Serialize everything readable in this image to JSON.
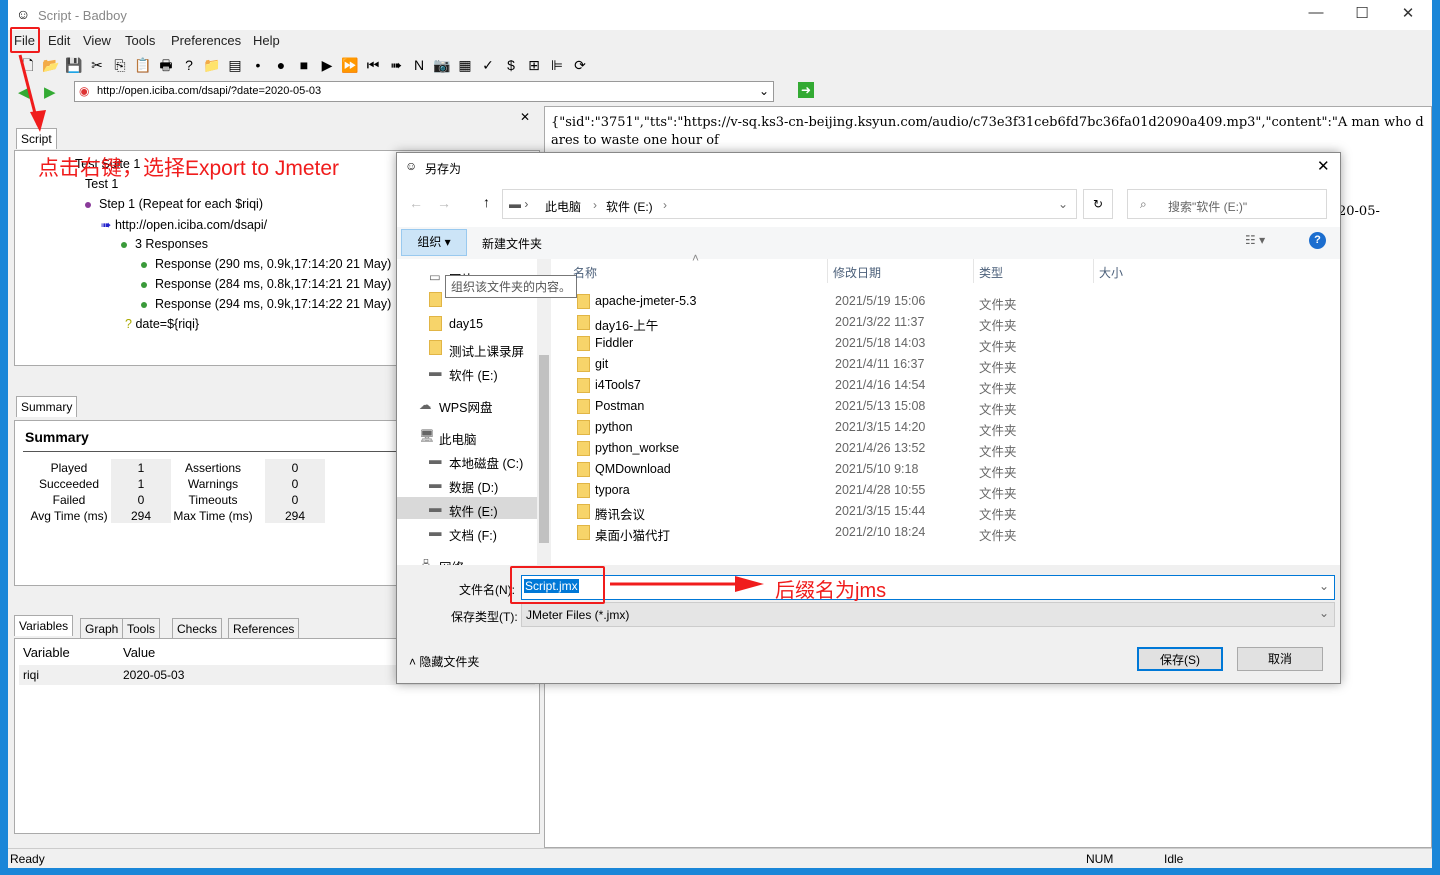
{
  "window": {
    "title": "Script - Badboy",
    "minimize": "—",
    "maximize": "☐",
    "close": "✕"
  },
  "menu": [
    "File",
    "Edit",
    "View",
    "Tools",
    "Preferences",
    "Help"
  ],
  "toolbar": [
    {
      "icon": "new-icon",
      "glyph": "🗋"
    },
    {
      "icon": "open-icon",
      "glyph": "📂"
    },
    {
      "icon": "save-icon",
      "glyph": "💾"
    },
    {
      "icon": "cut-icon",
      "glyph": "✂"
    },
    {
      "icon": "copy-icon",
      "glyph": "⎘"
    },
    {
      "icon": "paste-icon",
      "glyph": "📋"
    },
    {
      "icon": "print-icon",
      "glyph": "🖶"
    },
    {
      "icon": "help-icon",
      "glyph": "?"
    },
    {
      "icon": "add-suite-icon",
      "glyph": "📁"
    },
    {
      "icon": "add-test-icon",
      "glyph": "▤"
    },
    {
      "icon": "add-step-icon",
      "glyph": "•"
    },
    {
      "icon": "record-icon",
      "glyph": "●"
    },
    {
      "icon": "stop-icon",
      "glyph": "■"
    },
    {
      "icon": "play-icon",
      "glyph": "▶"
    },
    {
      "icon": "play-all-icon",
      "glyph": "⏩"
    },
    {
      "icon": "rewind-icon",
      "glyph": "⏮"
    },
    {
      "icon": "step-icon",
      "glyph": "➠"
    },
    {
      "icon": "n-icon",
      "glyph": "N"
    },
    {
      "icon": "camera-icon",
      "glyph": "📷"
    },
    {
      "icon": "report-icon",
      "glyph": "▦"
    },
    {
      "icon": "check-icon",
      "glyph": "✓"
    },
    {
      "icon": "dollar-icon",
      "glyph": "$"
    },
    {
      "icon": "table-icon",
      "glyph": "⊞"
    },
    {
      "icon": "chart-icon",
      "glyph": "⊫"
    },
    {
      "icon": "refresh-icon",
      "glyph": "⟳"
    }
  ],
  "address": {
    "url": "http://open.iciba.com/dsapi/?date=2020-05-03"
  },
  "script_tab": "Script",
  "tree": [
    "Test Suite 1",
    "Test 1",
    "Step 1 (Repeat for each $riqi)",
    "http://open.iciba.com/dsapi/",
    "3 Responses",
    "Response (290 ms, 0.9k,17:14:20 21 May)",
    "Response (284 ms, 0.8k,17:14:21 21 May)",
    "Response (294 ms, 0.9k,17:14:22 21 May)",
    "date=${riqi}"
  ],
  "summary": {
    "tab": "Summary",
    "heading": "Summary",
    "left": [
      [
        "Played",
        "1"
      ],
      [
        "Succeeded",
        "1"
      ],
      [
        "Failed",
        "0"
      ],
      [
        "Avg Time (ms)",
        "294"
      ]
    ],
    "right": [
      [
        "Assertions",
        "0"
      ],
      [
        "Warnings",
        "0"
      ],
      [
        "Timeouts",
        "0"
      ],
      [
        "Max Time (ms)",
        "294"
      ]
    ]
  },
  "bottom_tabs": [
    "Variables",
    "Graph",
    "Tools",
    "Checks",
    "References"
  ],
  "variables": {
    "headers": [
      "Variable",
      "Value"
    ],
    "rows": [
      [
        "riqi",
        "2020-05-03"
      ]
    ]
  },
  "response_text": "{\"sid\":\"3751\",\"tts\":\"https://v-sq.ks3-cn-beijing.ksyun.com/audio/c73e3f31ceb6fd7bc36fa01d2090a409.mp3\",\"content\":\"A man who dares to waste one hour of",
  "response_fragment": "20-05-",
  "status": {
    "left": "Ready",
    "num": "NUM",
    "state": "Idle"
  },
  "dialog": {
    "title": "另存为",
    "close": "✕",
    "breadcrumb": [
      "此电脑",
      "软件 (E:)"
    ],
    "search_placeholder": "搜索\"软件 (E:)\"",
    "organize": "组织 ▾",
    "new_folder": "新建文件夹",
    "tooltip": "组织该文件夹的内容。",
    "nav": [
      "图片",
      "",
      "day15",
      "测试上课录屏",
      "软件 (E:)",
      "WPS网盘",
      "此电脑",
      "本地磁盘 (C:)",
      "数据 (D:)",
      "软件 (E:)",
      "文档 (F:)",
      "网络"
    ],
    "columns": [
      "名称",
      "修改日期",
      "类型",
      "大小"
    ],
    "files": [
      [
        "apache-jmeter-5.3",
        "2021/5/19 15:06",
        "文件夹"
      ],
      [
        "day16-上午",
        "2021/3/22 11:37",
        "文件夹"
      ],
      [
        "Fiddler",
        "2021/5/18 14:03",
        "文件夹"
      ],
      [
        "git",
        "2021/4/11 16:37",
        "文件夹"
      ],
      [
        "i4Tools7",
        "2021/4/16 14:54",
        "文件夹"
      ],
      [
        "Postman",
        "2021/5/13 15:08",
        "文件夹"
      ],
      [
        "python",
        "2021/3/15 14:20",
        "文件夹"
      ],
      [
        "python_workse",
        "2021/4/26 13:52",
        "文件夹"
      ],
      [
        "QMDownload",
        "2021/5/10 9:18",
        "文件夹"
      ],
      [
        "typora",
        "2021/4/28 10:55",
        "文件夹"
      ],
      [
        "腾讯会议",
        "2021/3/15 15:44",
        "文件夹"
      ],
      [
        "桌面小猫代打",
        "2021/2/10 18:24",
        "文件夹"
      ]
    ],
    "filename_label": "文件名(N):",
    "filename": "Script.jmx",
    "filetype_label": "保存类型(T):",
    "filetype": "JMeter Files (*.jmx)",
    "hide_folders": "隐藏文件夹",
    "save": "保存(S)",
    "cancel": "取消"
  },
  "annotations": {
    "right_click": "点击右键，选择Export to Jmeter",
    "suffix": "后缀名为jms",
    "color": "#f01c1c"
  }
}
